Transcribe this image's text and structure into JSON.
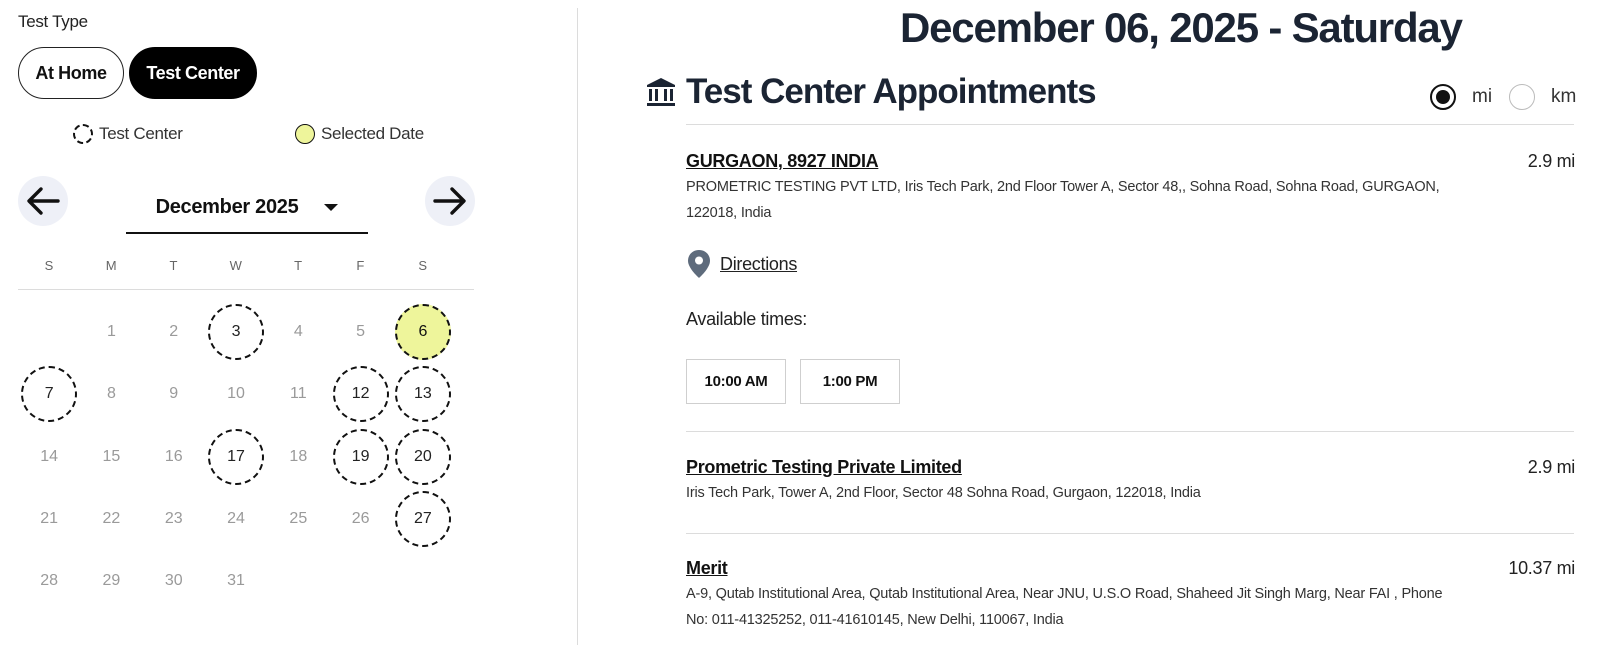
{
  "test_type": {
    "label": "Test Type",
    "options": [
      "At Home",
      "Test Center"
    ],
    "selected": "Test Center"
  },
  "legend": {
    "test_center": "Test Center",
    "selected_date": "Selected Date"
  },
  "calendar": {
    "month_label": "December 2025",
    "weekdays": [
      "S",
      "M",
      "T",
      "W",
      "T",
      "F",
      "S"
    ],
    "leading_blanks": 1,
    "days": [
      "1",
      "2",
      "3",
      "4",
      "5",
      "6",
      "7",
      "8",
      "9",
      "10",
      "11",
      "12",
      "13",
      "14",
      "15",
      "16",
      "17",
      "18",
      "19",
      "20",
      "21",
      "22",
      "23",
      "24",
      "25",
      "26",
      "27",
      "28",
      "29",
      "30",
      "31"
    ],
    "available_days": [
      "3",
      "6",
      "7",
      "12",
      "13",
      "17",
      "19",
      "20",
      "27"
    ],
    "selected_day": "6",
    "selected_color": "#eef59b"
  },
  "main": {
    "date_heading": "December 06, 2025 - Saturday",
    "section_title": "Test Center Appointments",
    "section_icon": "bank-icon",
    "units": {
      "mi": "mi",
      "km": "km",
      "selected": "mi"
    },
    "locations": [
      {
        "name": "GURGAON, 8927 INDIA",
        "address": "PROMETRIC TESTING PVT LTD, Iris Tech Park, 2nd Floor Tower A, Sector 48,, Sohna Road, Sohna Road, GURGAON, 122018, India",
        "distance": "2.9 mi",
        "directions_label": "Directions",
        "available_label": "Available times:",
        "times": [
          "10:00 AM",
          "1:00 PM"
        ]
      },
      {
        "name": "Prometric Testing Private Limited",
        "address": "Iris Tech Park, Tower A, 2nd Floor, Sector 48 Sohna Road, Gurgaon, 122018, India",
        "distance": "2.9 mi"
      },
      {
        "name": "Merit",
        "address": "A-9, Qutab Institutional Area, Qutab Institutional Area, Near JNU, U.S.O Road, Shaheed Jit Singh Marg, Near FAI , Phone No: 011-41325252, 011-41610145, New Delhi, 110067, India",
        "distance": "10.37 mi"
      }
    ]
  }
}
